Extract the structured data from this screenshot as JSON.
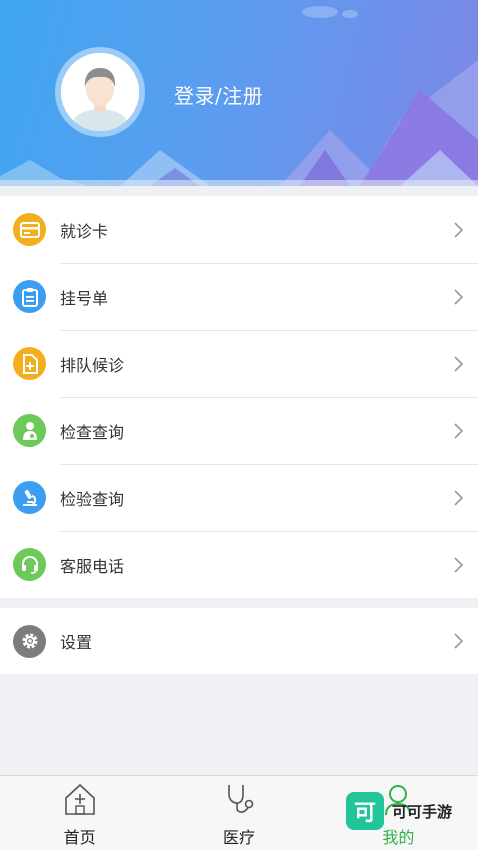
{
  "header": {
    "login_label": "登录/注册"
  },
  "menu": {
    "items": [
      {
        "label": "就诊卡",
        "icon": "card-icon",
        "color": "#f3ae1d"
      },
      {
        "label": "挂号单",
        "icon": "clipboard-icon",
        "color": "#3b9ef0"
      },
      {
        "label": "排队候诊",
        "icon": "queue-document-icon",
        "color": "#f3ae1d"
      },
      {
        "label": "检查查询",
        "icon": "doctor-icon",
        "color": "#6cc95a"
      },
      {
        "label": "检验查询",
        "icon": "microscope-icon",
        "color": "#3b9ef0"
      },
      {
        "label": "客服电话",
        "icon": "headset-icon",
        "color": "#6cc95a"
      }
    ],
    "settings": {
      "label": "设置",
      "icon": "gear-icon",
      "color": "#7c7c7c"
    }
  },
  "tabbar": {
    "tabs": [
      {
        "label": "首页",
        "icon": "home-icon",
        "active": false
      },
      {
        "label": "医疗",
        "icon": "stethoscope-icon",
        "active": false
      },
      {
        "label": "我的",
        "icon": "user-icon",
        "active": true
      }
    ],
    "active_color": "#2fb34a"
  },
  "watermark": {
    "logo_char": "可",
    "text": "可可手游"
  }
}
